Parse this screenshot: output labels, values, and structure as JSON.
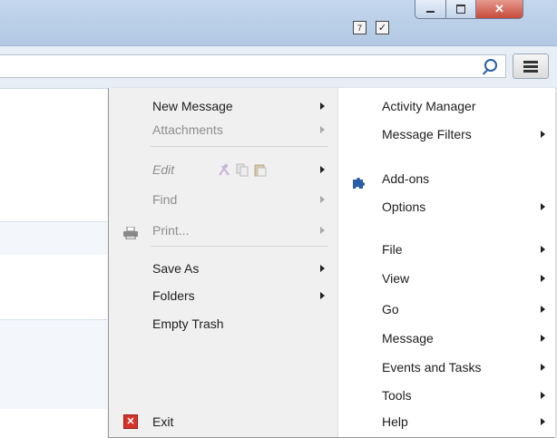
{
  "title_bar": {
    "icons": [
      "calendar-icon",
      "tasks-icon"
    ],
    "calendar_day": "7",
    "window_buttons": {
      "minimize": "minimize-icon",
      "maximize": "maximize-icon",
      "close": "close-icon"
    },
    "close_glyph": "✕"
  },
  "toolbar": {
    "search": {
      "value": "",
      "placeholder": ""
    },
    "menu_icon": "hamburger-menu-icon"
  },
  "menu": {
    "left": {
      "new_message": "New Message",
      "attachments": "Attachments",
      "edit": "Edit",
      "find": "Find",
      "print": "Print...",
      "save_as": "Save As",
      "folders": "Folders",
      "empty_trash": "Empty Trash",
      "exit": "Exit"
    },
    "right": {
      "activity_manager": "Activity Manager",
      "message_filters": "Message Filters",
      "add_ons": "Add-ons",
      "options": "Options",
      "file": "File",
      "view": "View",
      "go": "Go",
      "message": "Message",
      "events_and_tasks": "Events and Tasks",
      "tools": "Tools",
      "help": "Help"
    }
  },
  "colors": {
    "accent": "#2a5ea8",
    "close_button": "#c74b3a",
    "disabled_text": "#8e8e8e"
  }
}
